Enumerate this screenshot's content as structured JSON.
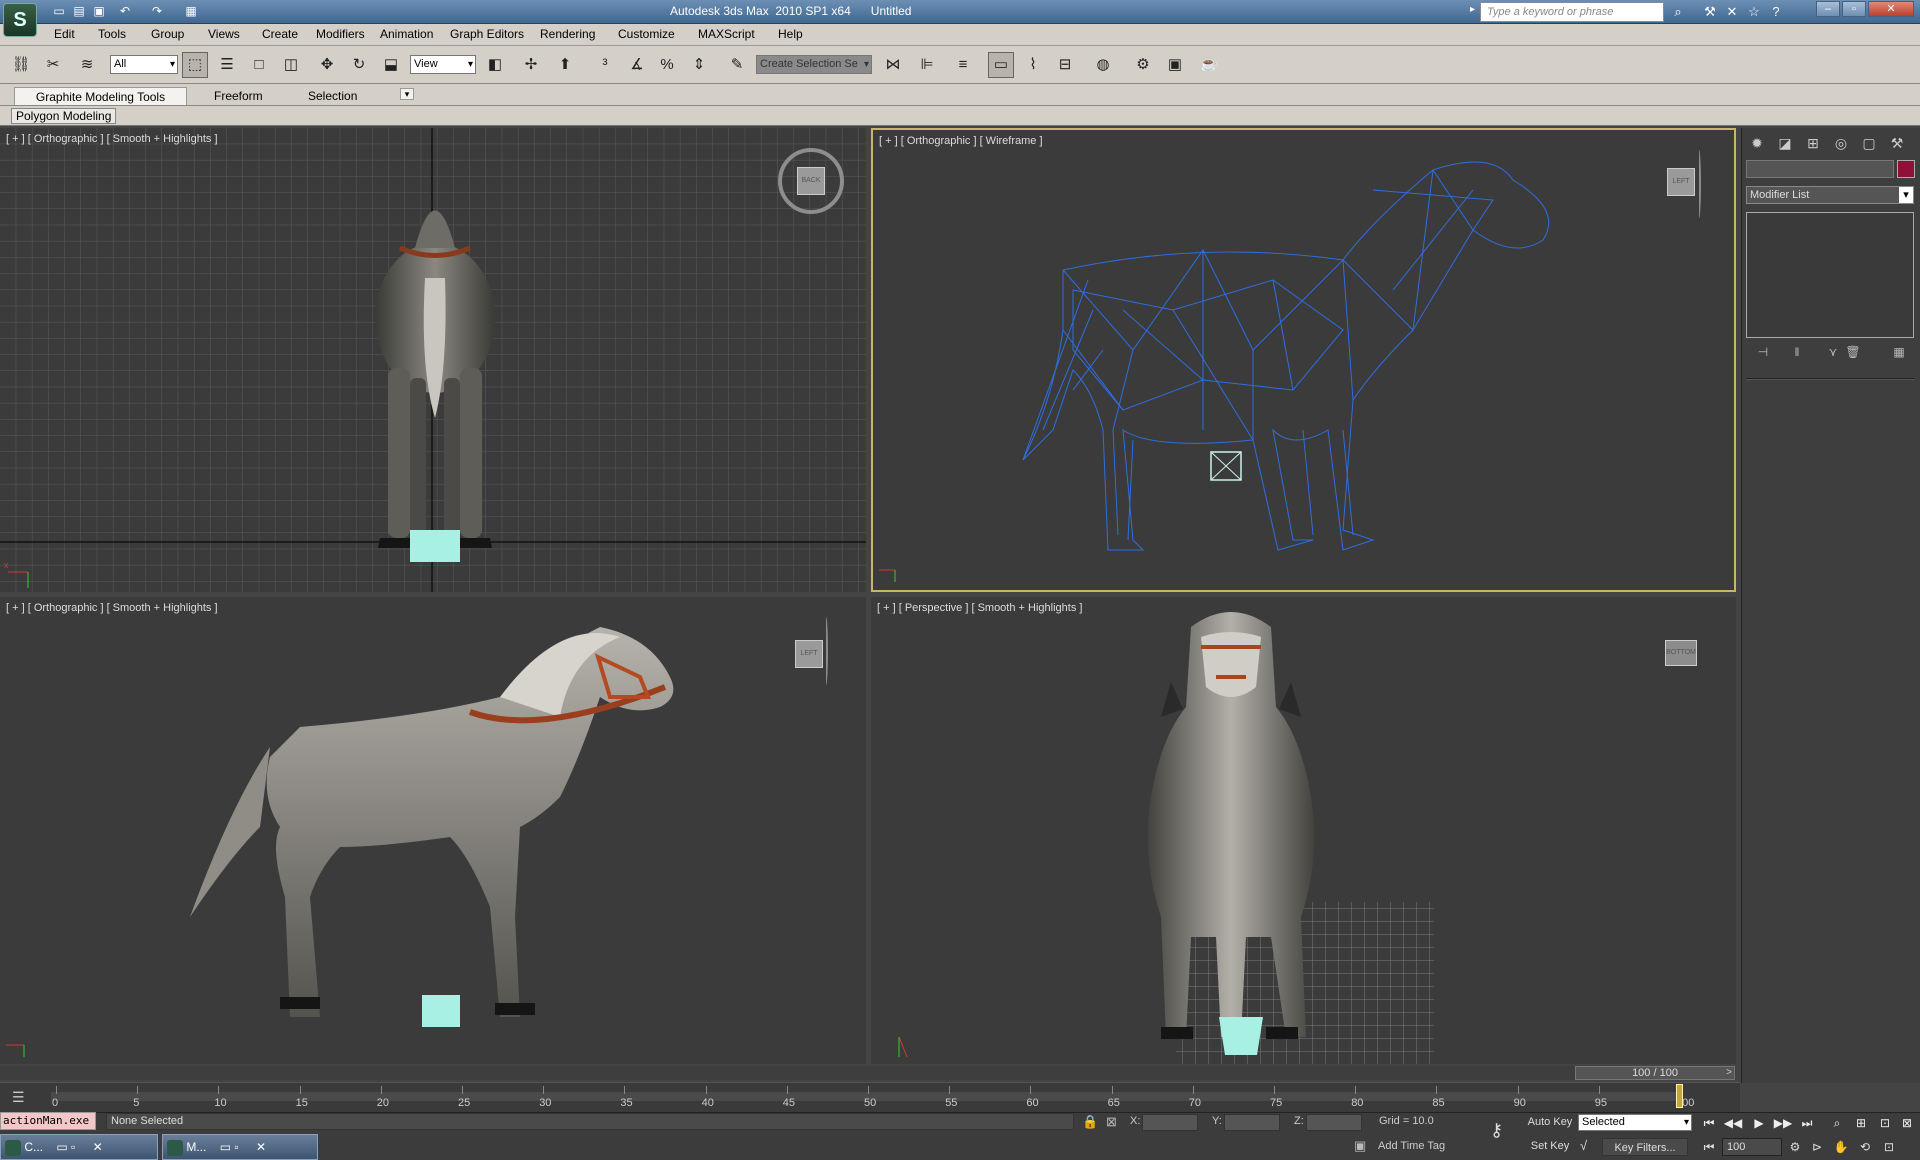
{
  "app": {
    "logo_glyph": "S",
    "title": "Autodesk 3ds Max  2010 SP1 x64      Untitled",
    "search_placeholder": "Type a keyword or phrase"
  },
  "menu": [
    "Edit",
    "Tools",
    "Group",
    "Views",
    "Create",
    "Modifiers",
    "Animation",
    "Graph Editors",
    "Rendering",
    "Customize",
    "MAXScript",
    "Help"
  ],
  "toolbar": {
    "selection_filter": "All",
    "reference_coord": "View",
    "named_selection": "Create Selection Se"
  },
  "ribbon": {
    "tabs": [
      "Graphite Modeling Tools",
      "Freeform",
      "Selection"
    ],
    "panel_label": "Polygon Modeling"
  },
  "viewports": {
    "top": "[ + ] [ Orthographic ] [ Smooth + Highlights ]",
    "front": "[ + ] [ Orthographic ] [ Wireframe ]",
    "left": "[ + ] [ Orthographic ] [ Smooth + Highlights ]",
    "perspective": "[ + ] [ Perspective ] [ Smooth + Highlights ]",
    "viewcube_labels": {
      "top": "BACK",
      "front": "LEFT",
      "left": "LEFT",
      "perspective": "BOTTOM"
    }
  },
  "command_panel": {
    "modifier_list": "Modifier List",
    "object_color": "#8e1138"
  },
  "timeline": {
    "range_label": "100 / 100",
    "current_frame": 100,
    "ticks": [
      0,
      5,
      10,
      15,
      20,
      25,
      30,
      35,
      40,
      45,
      50,
      55,
      60,
      65,
      70,
      75,
      80,
      85,
      90,
      95,
      100
    ]
  },
  "status": {
    "script_listener": "actionMan.exe",
    "prompt": "None Selected",
    "x_label": "X:",
    "y_label": "Y:",
    "z_label": "Z:",
    "grid": "Grid = 10.0",
    "add_time_tag": "Add Time Tag",
    "auto_key": "Auto Key",
    "set_key": "Set Key",
    "selection_set": "Selected",
    "key_filters": "Key Filters...",
    "frame_field": "100"
  },
  "taskbar": [
    {
      "label": "C..."
    },
    {
      "label": "M..."
    }
  ],
  "icons": [
    "undo-icon",
    "redo-icon",
    "select-icon",
    "move-icon",
    "rotate-icon",
    "scale-icon",
    "snap-icon",
    "mirror-icon",
    "align-icon",
    "render-icon",
    "teapot-icon",
    "play-icon",
    "zoom-icon",
    "pan-icon",
    "orbit-icon",
    "key-icon",
    "lock-icon",
    "help-icon"
  ]
}
